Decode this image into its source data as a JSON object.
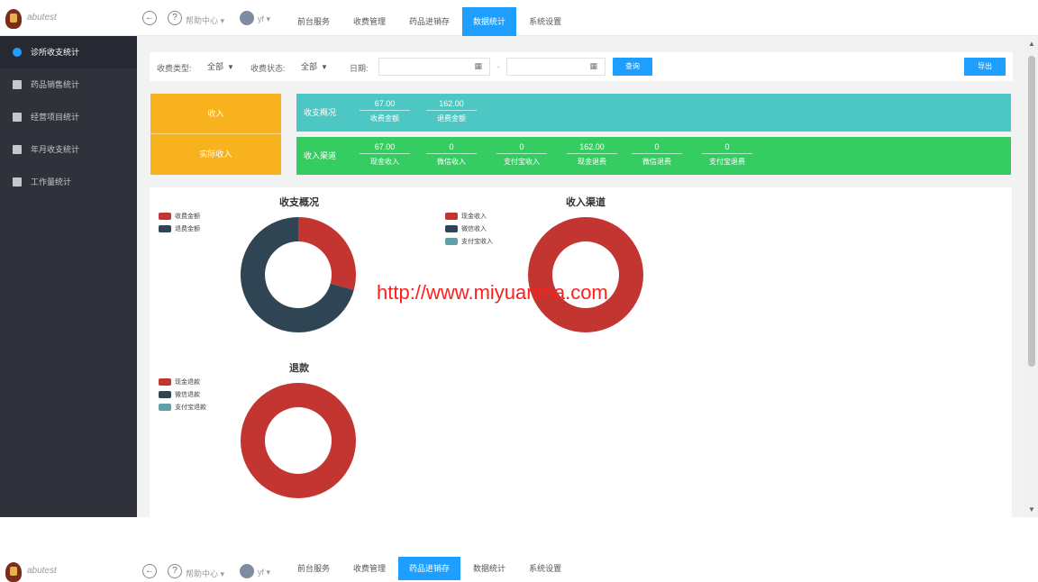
{
  "app": {
    "logo_text": "abutest"
  },
  "topbar": {
    "back_icon": "back-arrow-icon",
    "help_label": "帮助中心 ▾",
    "user_label": "yf ▾",
    "nav": [
      {
        "label": "前台服务",
        "active": false
      },
      {
        "label": "收费管理",
        "active": false
      },
      {
        "label": "药品进销存",
        "active": false
      },
      {
        "label": "数据统计",
        "active": true
      },
      {
        "label": "系统设置",
        "active": false
      }
    ]
  },
  "topbar2": {
    "nav": [
      {
        "label": "前台服务",
        "active": false
      },
      {
        "label": "收费管理",
        "active": false
      },
      {
        "label": "药品进销存",
        "active": true
      },
      {
        "label": "数据统计",
        "active": false
      },
      {
        "label": "系统设置",
        "active": false
      }
    ]
  },
  "sidebar": {
    "items": [
      {
        "label": "诊所收支统计",
        "icon": "pie-icon",
        "active": true
      },
      {
        "label": "药品销售统计",
        "icon": "box-icon",
        "active": false
      },
      {
        "label": "经营项目统计",
        "icon": "bar-chart-icon",
        "active": false
      },
      {
        "label": "年月收支统计",
        "icon": "line-chart-icon",
        "active": false
      },
      {
        "label": "工作量统计",
        "icon": "document-icon",
        "active": false
      }
    ]
  },
  "filter": {
    "fee_type_label": "收费类型:",
    "fee_type_value": "全部",
    "fee_status_label": "收费状态:",
    "fee_status_value": "全部",
    "date_label": "日期:",
    "date_sep": "-",
    "query_button": "查询",
    "export_button": "导出"
  },
  "summary": {
    "box_top": "收入",
    "box_bottom": "实际收入",
    "overview": {
      "title": "收支概况",
      "cells": [
        {
          "value": "67.00",
          "label": "收费金额"
        },
        {
          "value": "162.00",
          "label": "退费金额"
        }
      ]
    },
    "channel": {
      "title": "收入渠道",
      "cells": [
        {
          "value": "67.00",
          "label": "现金收入"
        },
        {
          "value": "0",
          "label": "微信收入"
        },
        {
          "value": "0",
          "label": "支付宝收入"
        },
        {
          "value": "162.00",
          "label": "现金退费"
        },
        {
          "value": "0",
          "label": "微信退费"
        },
        {
          "value": "0",
          "label": "支付宝退费"
        }
      ]
    }
  },
  "chart_data": [
    {
      "type": "pie",
      "title": "收支概况",
      "legend_position": "left",
      "labels": [
        "收费金额",
        "退费金额"
      ],
      "values": [
        67,
        162
      ],
      "colors": [
        "#c23531",
        "#2f4554"
      ]
    },
    {
      "type": "pie",
      "title": "收入渠道",
      "legend_position": "left",
      "labels": [
        "现金收入",
        "微信收入",
        "支付宝收入"
      ],
      "values": [
        67,
        0,
        0
      ],
      "colors": [
        "#c23531",
        "#2f4554",
        "#61a0a8"
      ]
    },
    {
      "type": "pie",
      "title": "退款",
      "legend_position": "left",
      "labels": [
        "现金退款",
        "微信退款",
        "支付宝退款"
      ],
      "values": [
        162,
        0,
        0
      ],
      "colors": [
        "#c23531",
        "#2f4554",
        "#61a0a8"
      ]
    }
  ],
  "watermark": "http://www.miyuanma.com",
  "colors": {
    "accent": "#1e9fff",
    "sidebar_bg": "#2f323a",
    "yellow": "#f8b21e",
    "teal": "#4cc7c4",
    "green": "#35cd62"
  }
}
